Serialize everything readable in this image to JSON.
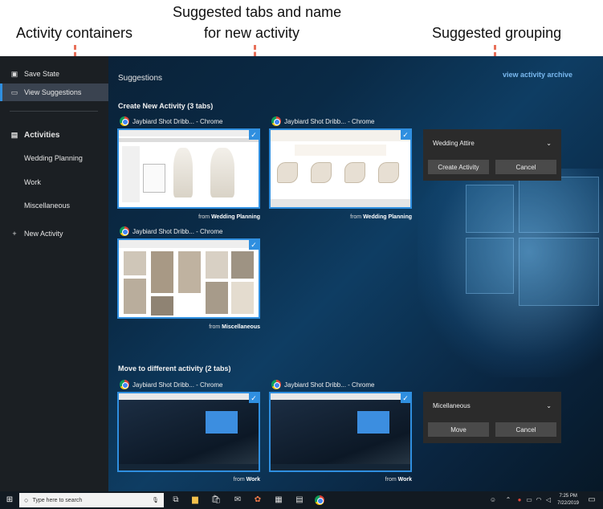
{
  "annotations": {
    "activity_containers": "Activity containers",
    "suggested_tabs_line1": "Suggested tabs and name",
    "suggested_tabs_line2": "for new activity",
    "suggested_grouping": "Suggested grouping"
  },
  "sidebar": {
    "save_state": "Save State",
    "view_suggestions": "View Suggestions",
    "activities_heading": "Activities",
    "items": [
      "Wedding Planning",
      "Work",
      "Miscellaneous"
    ],
    "new_activity": "New Activity"
  },
  "main": {
    "title": "Suggestions",
    "archive_link": "view activity archive",
    "section_new": "Create New Activity (3 tabs)",
    "section_move": "Move to different activity (2 tabs)",
    "tabs_new": [
      {
        "title": "Jaybiard Shot Dribb... - Chrome",
        "from_prefix": "from",
        "from": "Wedding Planning"
      },
      {
        "title": "Jaybiard Shot Dribb... - Chrome",
        "from_prefix": "from",
        "from": "Wedding Planning"
      },
      {
        "title": "Jaybiard Shot Dribb... - Chrome",
        "from_prefix": "from",
        "from": "Miscellaneous"
      }
    ],
    "tabs_move": [
      {
        "title": "Jaybiard Shot Dribb... - Chrome",
        "from_prefix": "from",
        "from": "Work"
      },
      {
        "title": "Jaybiard Shot Dribb... - Chrome",
        "from_prefix": "from",
        "from": "Work"
      }
    ],
    "create_panel": {
      "selected": "Wedding Attire",
      "primary": "Create Activity",
      "secondary": "Cancel"
    },
    "move_panel": {
      "selected": "Micellaneous",
      "primary": "Move",
      "secondary": "Cancel"
    }
  },
  "taskbar": {
    "search_placeholder": "Type here to search",
    "time": "7:25 PM",
    "date": "7/22/2019"
  }
}
